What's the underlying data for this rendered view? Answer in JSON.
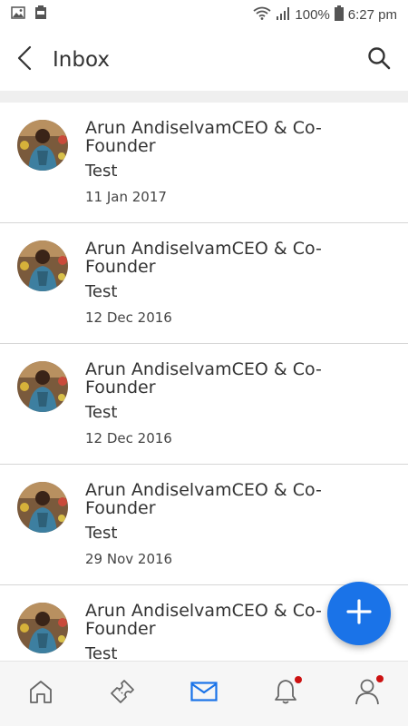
{
  "status_bar": {
    "battery_percent": "100%",
    "time": "6:27 pm",
    "left_icons": [
      "image-icon",
      "battery-saver-icon"
    ],
    "right_icons": [
      "wifi-icon",
      "signal-icon",
      "battery-icon"
    ]
  },
  "header": {
    "title": "Inbox",
    "back_icon": "chevron-left-icon",
    "search_icon": "search-icon"
  },
  "messages": [
    {
      "sender": "Arun AndiselvamCEO & Co-Founder",
      "subject": "Test",
      "date": "11 Jan 2017"
    },
    {
      "sender": "Arun AndiselvamCEO & Co-Founder",
      "subject": "Test",
      "date": "12 Dec 2016"
    },
    {
      "sender": "Arun AndiselvamCEO & Co-Founder",
      "subject": "Test",
      "date": "12 Dec 2016"
    },
    {
      "sender": "Arun AndiselvamCEO & Co-Founder",
      "subject": "Test",
      "date": "29 Nov 2016"
    },
    {
      "sender": "Arun AndiselvamCEO & Co-Founder",
      "subject": "Test",
      "date": ""
    }
  ],
  "fab": {
    "icon": "plus-icon"
  },
  "bottom_nav": {
    "items": [
      {
        "name": "home",
        "icon": "home-icon",
        "active": false,
        "badge": false
      },
      {
        "name": "tickets",
        "icon": "ticket-icon",
        "active": false,
        "badge": false
      },
      {
        "name": "inbox",
        "icon": "mail-icon",
        "active": true,
        "badge": false
      },
      {
        "name": "notifications",
        "icon": "bell-icon",
        "active": false,
        "badge": true
      },
      {
        "name": "profile",
        "icon": "person-icon",
        "active": false,
        "badge": true
      }
    ]
  },
  "colors": {
    "accent": "#1a73e8",
    "badge": "#cc1111",
    "text": "#333333",
    "band": "#efefef"
  }
}
